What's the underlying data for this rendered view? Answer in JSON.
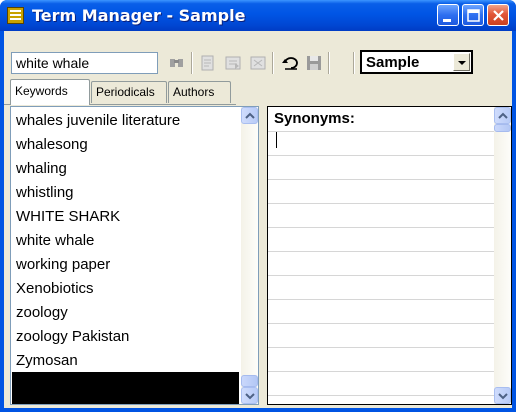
{
  "window": {
    "title": "Term Manager - Sample"
  },
  "toolbar": {
    "search_value": "white whale",
    "db_select_value": "Sample",
    "buttons": [
      "find-icon",
      "add-term-icon",
      "add-entry-icon",
      "delete-entry-icon",
      "undo-icon",
      "save-icon"
    ]
  },
  "tabs": [
    {
      "label": "Keywords",
      "active": true
    },
    {
      "label": "Periodicals",
      "active": false
    },
    {
      "label": "Authors",
      "active": false
    }
  ],
  "keywords": {
    "items": [
      "whales juvenile literature",
      "whalesong",
      "whaling",
      "whistling",
      "WHITE SHARK",
      "white whale",
      "working paper",
      "Xenobiotics",
      "zoology",
      "zoology Pakistan",
      "Zymosan"
    ]
  },
  "synonyms": {
    "header": "Synonyms:",
    "value": ""
  },
  "colors": {
    "titlebar": "#0054e3",
    "client": "#ece9d8"
  }
}
